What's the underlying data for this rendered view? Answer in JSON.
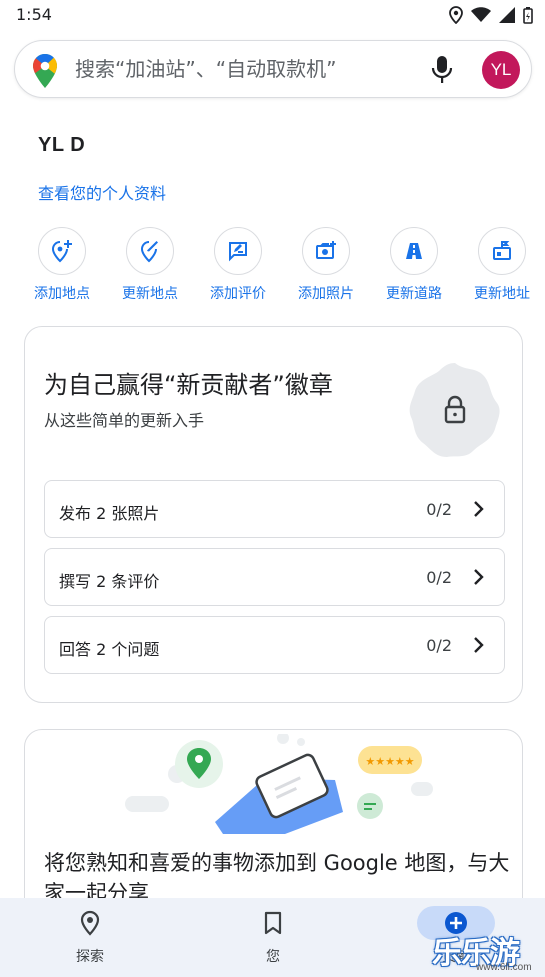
{
  "status_bar": {
    "time": "1:54"
  },
  "search": {
    "placeholder": "搜索“加油站”、“自动取款机”",
    "avatar_initials": "YL",
    "avatar_color": "#c2185b"
  },
  "profile": {
    "name": "YL D",
    "link_label": "查看您的个人资料"
  },
  "actions": [
    {
      "label": "添加地点",
      "icon": "add-place-icon"
    },
    {
      "label": "更新地点",
      "icon": "edit-place-icon"
    },
    {
      "label": "添加评价",
      "icon": "add-review-icon"
    },
    {
      "label": "添加照片",
      "icon": "add-photo-icon"
    },
    {
      "label": "更新道路",
      "icon": "road-icon"
    },
    {
      "label": "更新地址",
      "icon": "update-address-icon"
    }
  ],
  "badge_card": {
    "title": "为自己赢得“新贡献者”徽章",
    "subtitle": "从这些简单的更新入手",
    "tasks": [
      {
        "label": "发布 2 张照片",
        "progress": "0/2"
      },
      {
        "label": "撰写 2 条评价",
        "progress": "0/2"
      },
      {
        "label": "回答 2 个问题",
        "progress": "0/2"
      }
    ]
  },
  "promo_card": {
    "text": "将您熟知和喜爱的事物添加到 Google 地图，与大家一起分享"
  },
  "bottom_nav": [
    {
      "label": "探索",
      "icon": "location-pin-icon"
    },
    {
      "label": "您",
      "icon": "bookmark-icon"
    },
    {
      "label": "贡献",
      "icon": "add-circle-icon",
      "active": true
    }
  ],
  "watermark": {
    "text": "乐乐游戏",
    "url": "www.6ll.com"
  },
  "colors": {
    "accent": "#1a73e8",
    "nav_bg": "#eef2f9",
    "border": "#dadce0"
  }
}
